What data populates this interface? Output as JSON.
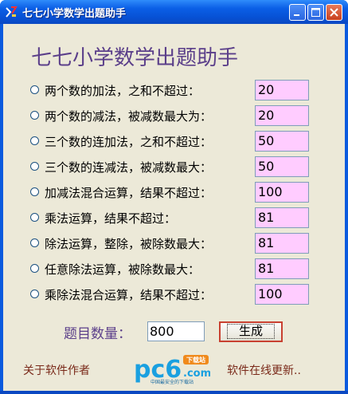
{
  "window": {
    "title": "七七小学数学出题助手",
    "controls": [
      "minimize",
      "maximize",
      "close"
    ]
  },
  "heading": "七七小学数学出题助手",
  "options": [
    {
      "label": "两个数的加法，之和不超过：",
      "value": "20",
      "bg": "#ffccff"
    },
    {
      "label": "两个数的减法，被减数最大为：",
      "value": "20",
      "bg": "#ffccff"
    },
    {
      "label": "三个数的连加法，之和不超过：",
      "value": "50",
      "bg": "#ffccff"
    },
    {
      "label": "三个数的连减法，被减数最大：",
      "value": "50",
      "bg": "#ffccff"
    },
    {
      "label": "加减法混合运算，结果不超过：",
      "value": "100",
      "bg": "#ffccff"
    },
    {
      "label": "乘法运算，结果不超过：",
      "value": "81",
      "bg": "#ffccff"
    },
    {
      "label": "除法运算，整除，被除数最大：",
      "value": "81",
      "bg": "#ffccff"
    },
    {
      "label": "任意除法运算，被除数最大：",
      "value": "81",
      "bg": "#ffccff"
    },
    {
      "label": "乘除法混合运算，结果不超过：",
      "value": "100",
      "bg": "#ffccff"
    }
  ],
  "count": {
    "label": "题目数量：",
    "value": "800"
  },
  "generate_label": "生成",
  "footer": {
    "about": "关于软件作者",
    "logo_brand": "pc6",
    "logo_badge": "下载站",
    "logo_domain": ".com",
    "logo_tagline": "中国最安全的下载站",
    "update": "软件在线更新.."
  },
  "colors": {
    "title_bar": "#0a5ade",
    "client_bg": "#ece9d8",
    "heading": "#5b3f8a",
    "field_bg": "#ffccff"
  }
}
